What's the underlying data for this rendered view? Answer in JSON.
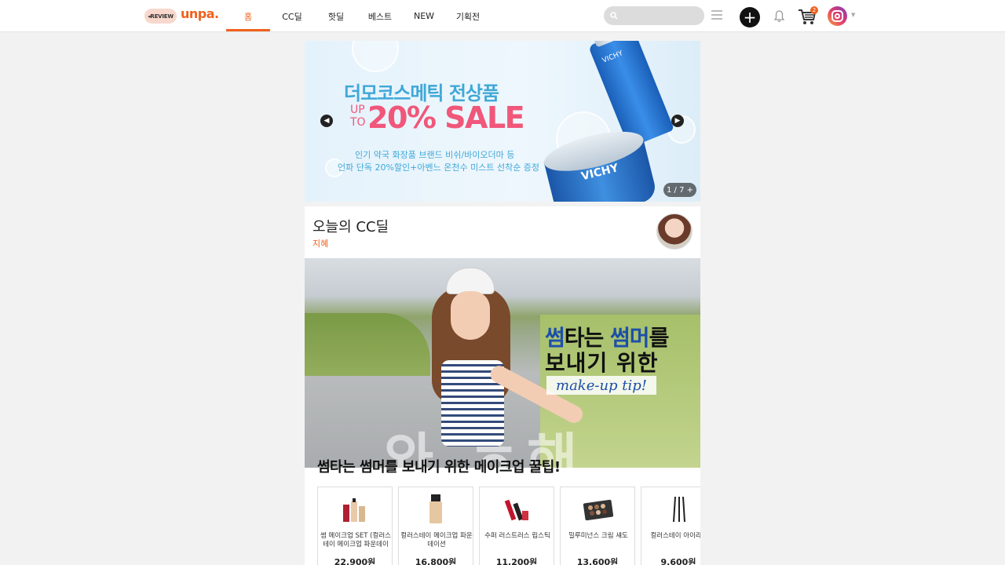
{
  "header": {
    "review_label": "◂REVIEW",
    "logo": "unpa.",
    "nav": [
      {
        "label": "홈",
        "active": true
      },
      {
        "label": "CC딜",
        "active": false
      },
      {
        "label": "핫딜",
        "active": false
      },
      {
        "label": "베스트",
        "active": false
      },
      {
        "label": "NEW",
        "active": false
      },
      {
        "label": "기획전",
        "active": false
      }
    ],
    "search_placeholder": "",
    "cart_count": "2",
    "icons": [
      "search-icon",
      "menu-icon",
      "plus-icon",
      "bell-icon",
      "cart-icon",
      "instagram-icon",
      "caret-down-icon"
    ],
    "accent_color": "#f0611c"
  },
  "banner": {
    "title": "더모코스메틱 전상품",
    "upto": "UP TO",
    "sale": "20% SALE",
    "sub1": "인기 약국 화장품 브랜드 비쉬/바이오더마 등",
    "sub2": "언파 단독 20%할인+아벤느 온천수 미스트 선착순 증정",
    "bottle_label": "VICHY",
    "jar_label": "VICHY",
    "counter": "1 / 7 +"
  },
  "cc_deal": {
    "title": "오늘의 CC딜",
    "author": "지혜",
    "photo_line1_a": "썸",
    "photo_line1_b": "타는 ",
    "photo_line1_c": "썸머",
    "photo_line1_d": "를",
    "photo_line2": "보내기  위한",
    "photo_tip": "make-up tip!",
    "road_text": "와 ㅎ해",
    "caption": "썸타는 썸머를 보내기 위한 메이크업 꿀팁!"
  },
  "products": [
    {
      "name": "썸 메이크업 SET (컬러스테이 메이크업 파운데이",
      "price": "22,900원"
    },
    {
      "name": "컬러스테이 메이크업 파운데이션",
      "price": "16,800원"
    },
    {
      "name": "수퍼 러스트러스 립스틱",
      "price": "11,200원"
    },
    {
      "name": "밀루미넌스 크림 섀도",
      "price": "13,600원"
    },
    {
      "name": "컬러스테이 아이라이",
      "price": "9,600원"
    }
  ]
}
